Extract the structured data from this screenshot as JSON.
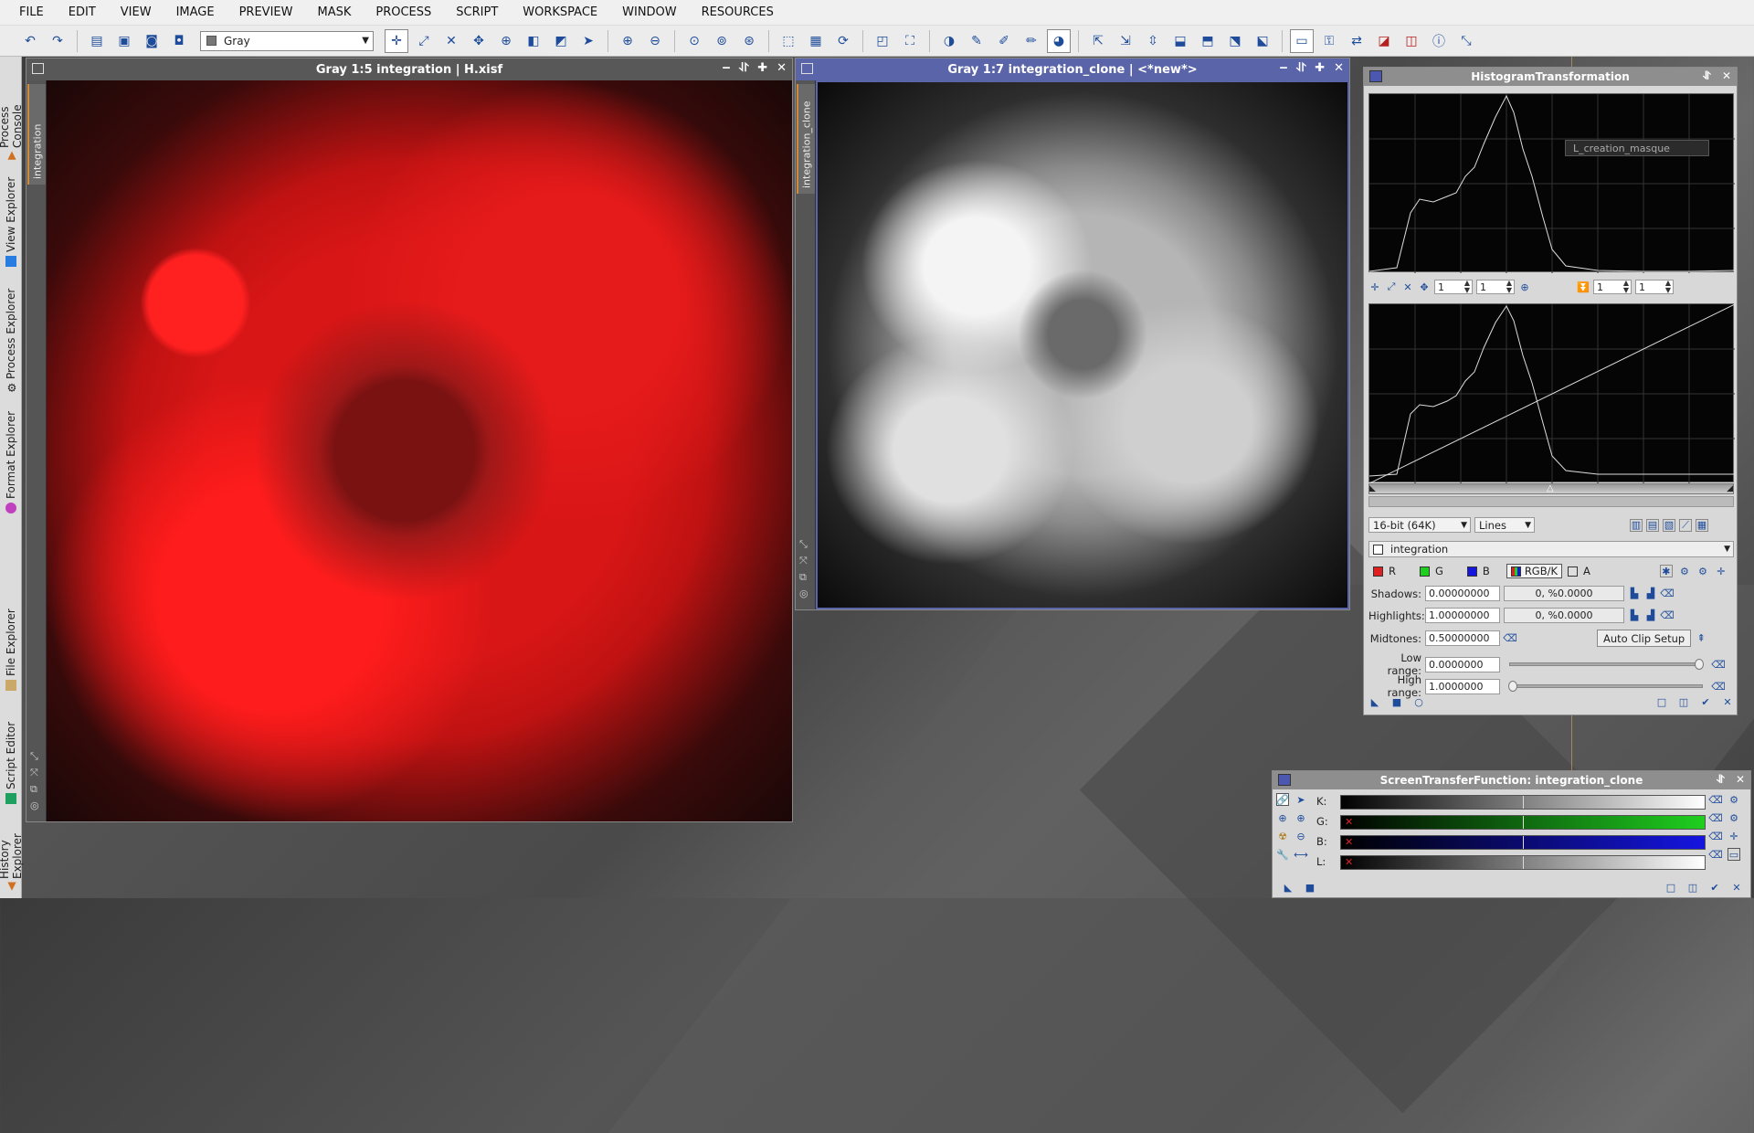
{
  "menubar": [
    "FILE",
    "EDIT",
    "VIEW",
    "IMAGE",
    "PREVIEW",
    "MASK",
    "PROCESS",
    "SCRIPT",
    "WORKSPACE",
    "WINDOW",
    "RESOURCES"
  ],
  "toolbar": {
    "view_select": "Gray"
  },
  "sidebar": [
    "Process Console",
    "View Explorer",
    "Process Explorer",
    "Format Explorer",
    "File Explorer",
    "Script Editor",
    "History Explorer"
  ],
  "windows": {
    "left": {
      "title": "Gray 1:5 integration | H.xisf",
      "tab": "integration"
    },
    "right": {
      "title": "Gray 1:7 integration_clone | <*new*>",
      "tab": "integration_clone"
    }
  },
  "histogram": {
    "title": "HistogramTransformation",
    "overlay_label": "L_creation_masque",
    "zoom_h": "1",
    "zoom_v": "1",
    "zoom2_h": "1",
    "zoom2_v": "1",
    "resolution": "16-bit (64K)",
    "graph_style": "Lines",
    "view": "integration",
    "channels": {
      "r": "R",
      "g": "G",
      "b": "B",
      "rgbk": "RGB/K",
      "a": "A"
    },
    "shadows_label": "Shadows:",
    "shadows": "0.00000000",
    "shadows_clip": "0, %0.0000",
    "highlights_label": "Highlights:",
    "highlights": "1.00000000",
    "highlights_clip": "0, %0.0000",
    "midtones_label": "Midtones:",
    "midtones": "0.50000000",
    "auto_clip": "Auto Clip Setup",
    "low_range_label": "Low range:",
    "low_range": "0.0000000",
    "high_range_label": "High range:",
    "high_range": "1.0000000"
  },
  "stf": {
    "title": "ScreenTransferFunction: integration_clone",
    "k": "K:",
    "g": "G:",
    "b": "B:",
    "l": "L:"
  },
  "colors": {
    "accent": "#5a64a8",
    "red": "#e02020",
    "green": "#1fcf1f",
    "blue": "#1515e0"
  }
}
